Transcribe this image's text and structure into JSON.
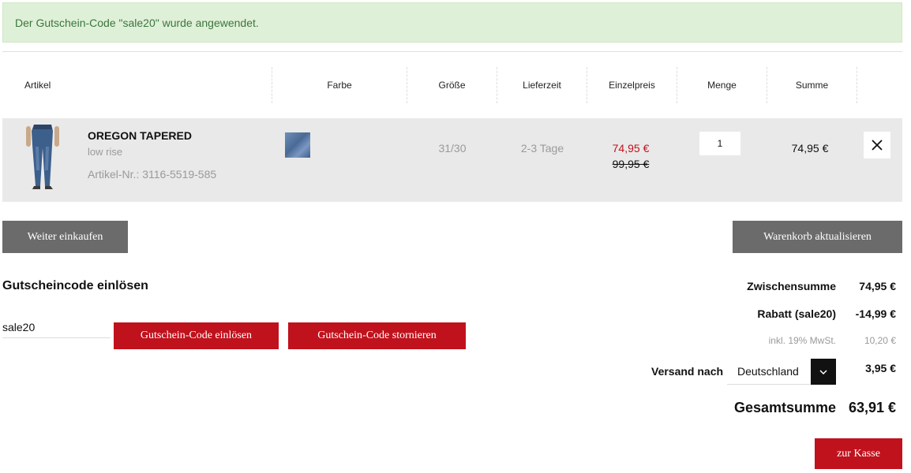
{
  "notice": {
    "text": "Der Gutschein-Code \"sale20\" wurde angewendet."
  },
  "table": {
    "headers": [
      "Artikel",
      "Farbe",
      "Größe",
      "Lieferzeit",
      "Einzelpreis",
      "Menge",
      "Summe"
    ]
  },
  "cart_item": {
    "name": "OREGON TAPERED",
    "subtitle": "low rise",
    "article_no": "Artikel-Nr.: 3116-5519-585",
    "size": "31/30",
    "delivery": "2-3 Tage",
    "price_new": "74,95 €",
    "price_old": "99,95 €",
    "quantity": "1",
    "sum": "74,95 €",
    "swatch_color": "#5a7aa8"
  },
  "buttons": {
    "continue": "Weiter einkaufen",
    "update_cart": "Warenkorb aktualisieren",
    "redeem": "Gutschein-Code einlösen",
    "cancel_coupon": "Gutschein-Code stornieren",
    "checkout": "zur Kasse"
  },
  "coupon": {
    "title": "Gutscheincode einlösen",
    "value": "sale20"
  },
  "totals": {
    "subtotal_label": "Zwischensumme",
    "subtotal_value": "74,95 €",
    "discount_label": "Rabatt (sale20)",
    "discount_value": "-14,99 €",
    "tax_label": "inkl. 19% MwSt.",
    "tax_value": "10,20 €",
    "shipping_label": "Versand nach",
    "shipping_country": "Deutschland",
    "shipping_value": "3,95 €",
    "grand_label": "Gesamtsumme",
    "grand_value": "63,91 €"
  },
  "colors": {
    "accent_red": "#c0121d",
    "button_grey": "#6b6b6b",
    "notice_bg": "#dff0d8",
    "notice_text": "#3c763d"
  },
  "icons": {
    "remove": "close-icon",
    "dropdown": "chevron-down-icon"
  }
}
